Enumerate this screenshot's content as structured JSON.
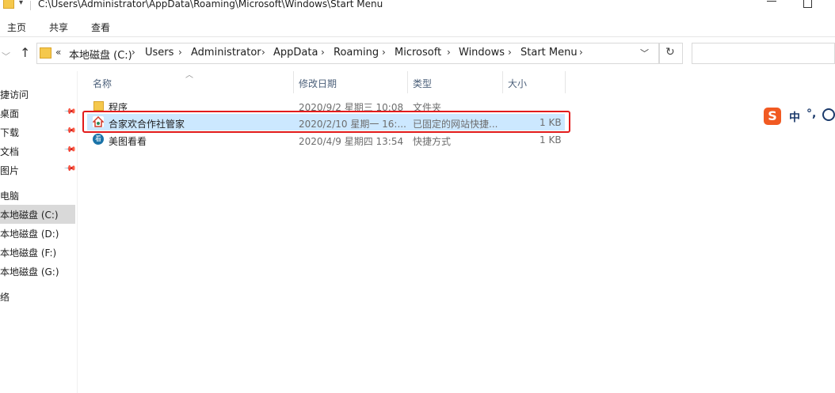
{
  "window": {
    "title": "C:\\Users\\Administrator\\AppData\\Roaming\\Microsoft\\Windows\\Start Menu"
  },
  "ribbon": {
    "tabs": [
      "主页",
      "共享",
      "查看"
    ]
  },
  "address": {
    "prefix": "«",
    "crumbs": [
      "本地磁盘 (C:)",
      "Users",
      "Administrator",
      "AppData",
      "Roaming",
      "Microsoft",
      "Windows",
      "Start Menu"
    ]
  },
  "nav": {
    "items": [
      {
        "label": "捷访问",
        "pinned": false
      },
      {
        "label": "桌面",
        "pinned": true
      },
      {
        "label": "下载",
        "pinned": true
      },
      {
        "label": "文档",
        "pinned": true
      },
      {
        "label": "图片",
        "pinned": true
      },
      {
        "label": "电脑",
        "pinned": false
      },
      {
        "label": "本地磁盘 (C:)",
        "pinned": false,
        "selected": true
      },
      {
        "label": "本地磁盘 (D:)",
        "pinned": false
      },
      {
        "label": "本地磁盘 (F:)",
        "pinned": false
      },
      {
        "label": "本地磁盘 (G:)",
        "pinned": false
      },
      {
        "label": "络",
        "pinned": false
      }
    ]
  },
  "columns": [
    "名称",
    "修改日期",
    "类型",
    "大小"
  ],
  "files": [
    {
      "name": "程序",
      "date": "2020/9/2 星期三 10:08",
      "type": "文件夹",
      "size": "",
      "icon": "folder-icon"
    },
    {
      "name": "合家欢合作社管家",
      "date": "2020/2/10 星期一 16:...",
      "type": "已固定的网站快捷...",
      "size": "1 KB",
      "icon": "app-icon",
      "highlighted": true
    },
    {
      "name": "美图看看",
      "date": "2020/4/9 星期四 13:54",
      "type": "快捷方式",
      "size": "1 KB",
      "icon": "meitu-icon"
    }
  ],
  "ime": {
    "logo": "S",
    "mode": "中",
    "punct": "°,"
  },
  "colors": {
    "selection": "#cce8ff",
    "highlight_border": "#e21b1b",
    "folder": "#f5c84c",
    "ime_brand": "#f15a22"
  }
}
